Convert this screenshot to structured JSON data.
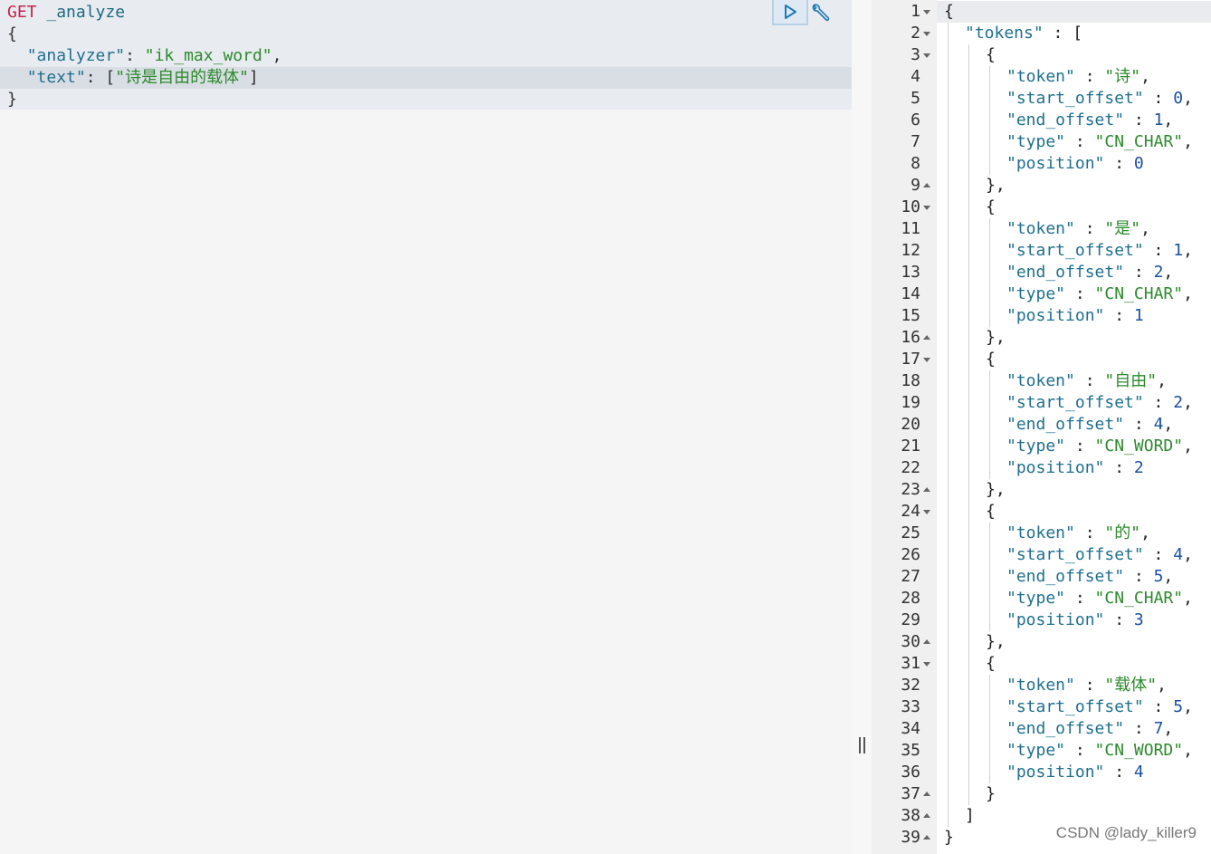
{
  "request": {
    "method": "GET",
    "endpoint": "_analyze",
    "open_brace": "{",
    "close_brace": "}",
    "analyzer_key": "\"analyzer\"",
    "analyzer_value": "\"ik_max_word\"",
    "text_key": "\"text\"",
    "text_value": "\"诗是自由的载体\""
  },
  "response": {
    "line_count": 39,
    "lines": [
      {
        "n": "1",
        "fold": "down",
        "indent": 0,
        "parts": [
          [
            "p",
            "{"
          ]
        ]
      },
      {
        "n": "2",
        "fold": "down",
        "indent": 1,
        "parts": [
          [
            "k",
            "\"tokens\""
          ],
          [
            "p",
            " : ["
          ]
        ]
      },
      {
        "n": "3",
        "fold": "down",
        "indent": 2,
        "parts": [
          [
            "p",
            "{"
          ]
        ]
      },
      {
        "n": "4",
        "fold": "",
        "indent": 3,
        "parts": [
          [
            "k",
            "\"token\""
          ],
          [
            "p",
            " : "
          ],
          [
            "s",
            "\"诗\""
          ],
          [
            "p",
            ","
          ]
        ]
      },
      {
        "n": "5",
        "fold": "",
        "indent": 3,
        "parts": [
          [
            "k",
            "\"start_offset\""
          ],
          [
            "p",
            " : "
          ],
          [
            "n",
            "0"
          ],
          [
            "p",
            ","
          ]
        ]
      },
      {
        "n": "6",
        "fold": "",
        "indent": 3,
        "parts": [
          [
            "k",
            "\"end_offset\""
          ],
          [
            "p",
            " : "
          ],
          [
            "n",
            "1"
          ],
          [
            "p",
            ","
          ]
        ]
      },
      {
        "n": "7",
        "fold": "",
        "indent": 3,
        "parts": [
          [
            "k",
            "\"type\""
          ],
          [
            "p",
            " : "
          ],
          [
            "s",
            "\"CN_CHAR\""
          ],
          [
            "p",
            ","
          ]
        ]
      },
      {
        "n": "8",
        "fold": "",
        "indent": 3,
        "parts": [
          [
            "k",
            "\"position\""
          ],
          [
            "p",
            " : "
          ],
          [
            "n",
            "0"
          ]
        ]
      },
      {
        "n": "9",
        "fold": "up",
        "indent": 2,
        "parts": [
          [
            "p",
            "},"
          ]
        ]
      },
      {
        "n": "10",
        "fold": "down",
        "indent": 2,
        "parts": [
          [
            "p",
            "{"
          ]
        ]
      },
      {
        "n": "11",
        "fold": "",
        "indent": 3,
        "parts": [
          [
            "k",
            "\"token\""
          ],
          [
            "p",
            " : "
          ],
          [
            "s",
            "\"是\""
          ],
          [
            "p",
            ","
          ]
        ]
      },
      {
        "n": "12",
        "fold": "",
        "indent": 3,
        "parts": [
          [
            "k",
            "\"start_offset\""
          ],
          [
            "p",
            " : "
          ],
          [
            "n",
            "1"
          ],
          [
            "p",
            ","
          ]
        ]
      },
      {
        "n": "13",
        "fold": "",
        "indent": 3,
        "parts": [
          [
            "k",
            "\"end_offset\""
          ],
          [
            "p",
            " : "
          ],
          [
            "n",
            "2"
          ],
          [
            "p",
            ","
          ]
        ]
      },
      {
        "n": "14",
        "fold": "",
        "indent": 3,
        "parts": [
          [
            "k",
            "\"type\""
          ],
          [
            "p",
            " : "
          ],
          [
            "s",
            "\"CN_CHAR\""
          ],
          [
            "p",
            ","
          ]
        ]
      },
      {
        "n": "15",
        "fold": "",
        "indent": 3,
        "parts": [
          [
            "k",
            "\"position\""
          ],
          [
            "p",
            " : "
          ],
          [
            "n",
            "1"
          ]
        ]
      },
      {
        "n": "16",
        "fold": "up",
        "indent": 2,
        "parts": [
          [
            "p",
            "},"
          ]
        ]
      },
      {
        "n": "17",
        "fold": "down",
        "indent": 2,
        "parts": [
          [
            "p",
            "{"
          ]
        ]
      },
      {
        "n": "18",
        "fold": "",
        "indent": 3,
        "parts": [
          [
            "k",
            "\"token\""
          ],
          [
            "p",
            " : "
          ],
          [
            "s",
            "\"自由\""
          ],
          [
            "p",
            ","
          ]
        ]
      },
      {
        "n": "19",
        "fold": "",
        "indent": 3,
        "parts": [
          [
            "k",
            "\"start_offset\""
          ],
          [
            "p",
            " : "
          ],
          [
            "n",
            "2"
          ],
          [
            "p",
            ","
          ]
        ]
      },
      {
        "n": "20",
        "fold": "",
        "indent": 3,
        "parts": [
          [
            "k",
            "\"end_offset\""
          ],
          [
            "p",
            " : "
          ],
          [
            "n",
            "4"
          ],
          [
            "p",
            ","
          ]
        ]
      },
      {
        "n": "21",
        "fold": "",
        "indent": 3,
        "parts": [
          [
            "k",
            "\"type\""
          ],
          [
            "p",
            " : "
          ],
          [
            "s",
            "\"CN_WORD\""
          ],
          [
            "p",
            ","
          ]
        ]
      },
      {
        "n": "22",
        "fold": "",
        "indent": 3,
        "parts": [
          [
            "k",
            "\"position\""
          ],
          [
            "p",
            " : "
          ],
          [
            "n",
            "2"
          ]
        ]
      },
      {
        "n": "23",
        "fold": "up",
        "indent": 2,
        "parts": [
          [
            "p",
            "},"
          ]
        ]
      },
      {
        "n": "24",
        "fold": "down",
        "indent": 2,
        "parts": [
          [
            "p",
            "{"
          ]
        ]
      },
      {
        "n": "25",
        "fold": "",
        "indent": 3,
        "parts": [
          [
            "k",
            "\"token\""
          ],
          [
            "p",
            " : "
          ],
          [
            "s",
            "\"的\""
          ],
          [
            "p",
            ","
          ]
        ]
      },
      {
        "n": "26",
        "fold": "",
        "indent": 3,
        "parts": [
          [
            "k",
            "\"start_offset\""
          ],
          [
            "p",
            " : "
          ],
          [
            "n",
            "4"
          ],
          [
            "p",
            ","
          ]
        ]
      },
      {
        "n": "27",
        "fold": "",
        "indent": 3,
        "parts": [
          [
            "k",
            "\"end_offset\""
          ],
          [
            "p",
            " : "
          ],
          [
            "n",
            "5"
          ],
          [
            "p",
            ","
          ]
        ]
      },
      {
        "n": "28",
        "fold": "",
        "indent": 3,
        "parts": [
          [
            "k",
            "\"type\""
          ],
          [
            "p",
            " : "
          ],
          [
            "s",
            "\"CN_CHAR\""
          ],
          [
            "p",
            ","
          ]
        ]
      },
      {
        "n": "29",
        "fold": "",
        "indent": 3,
        "parts": [
          [
            "k",
            "\"position\""
          ],
          [
            "p",
            " : "
          ],
          [
            "n",
            "3"
          ]
        ]
      },
      {
        "n": "30",
        "fold": "up",
        "indent": 2,
        "parts": [
          [
            "p",
            "},"
          ]
        ]
      },
      {
        "n": "31",
        "fold": "down",
        "indent": 2,
        "parts": [
          [
            "p",
            "{"
          ]
        ]
      },
      {
        "n": "32",
        "fold": "",
        "indent": 3,
        "parts": [
          [
            "k",
            "\"token\""
          ],
          [
            "p",
            " : "
          ],
          [
            "s",
            "\"载体\""
          ],
          [
            "p",
            ","
          ]
        ]
      },
      {
        "n": "33",
        "fold": "",
        "indent": 3,
        "parts": [
          [
            "k",
            "\"start_offset\""
          ],
          [
            "p",
            " : "
          ],
          [
            "n",
            "5"
          ],
          [
            "p",
            ","
          ]
        ]
      },
      {
        "n": "34",
        "fold": "",
        "indent": 3,
        "parts": [
          [
            "k",
            "\"end_offset\""
          ],
          [
            "p",
            " : "
          ],
          [
            "n",
            "7"
          ],
          [
            "p",
            ","
          ]
        ]
      },
      {
        "n": "35",
        "fold": "",
        "indent": 3,
        "parts": [
          [
            "k",
            "\"type\""
          ],
          [
            "p",
            " : "
          ],
          [
            "s",
            "\"CN_WORD\""
          ],
          [
            "p",
            ","
          ]
        ]
      },
      {
        "n": "36",
        "fold": "",
        "indent": 3,
        "parts": [
          [
            "k",
            "\"position\""
          ],
          [
            "p",
            " : "
          ],
          [
            "n",
            "4"
          ]
        ]
      },
      {
        "n": "37",
        "fold": "up",
        "indent": 2,
        "parts": [
          [
            "p",
            "}"
          ]
        ]
      },
      {
        "n": "38",
        "fold": "up",
        "indent": 1,
        "parts": [
          [
            "p",
            "]"
          ]
        ]
      },
      {
        "n": "39",
        "fold": "up",
        "indent": 0,
        "parts": [
          [
            "p",
            "}"
          ]
        ]
      }
    ]
  },
  "watermark": "CSDN @lady_killer9",
  "icons": {
    "run": "play-icon",
    "settings": "wrench-icon",
    "resize": "resize-handle-icon"
  },
  "colors": {
    "method": "#c7254e",
    "key": "#1f6f8f",
    "string": "#2c8a2c",
    "number": "#1a4fa0"
  }
}
